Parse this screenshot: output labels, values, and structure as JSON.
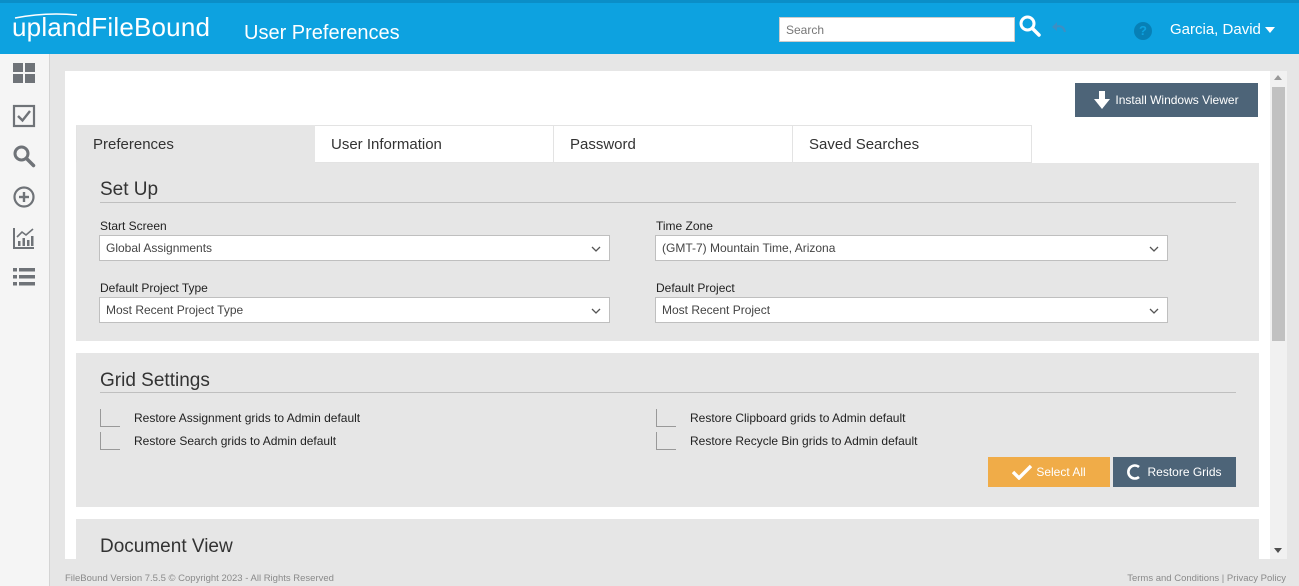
{
  "header": {
    "logo_prefix": "upland",
    "logo_name": "FileBound",
    "page_title": "User Preferences",
    "search_placeholder": "Search",
    "search_value": "",
    "search_icon": "search-icon",
    "back_icon": "undo-icon",
    "help_label": "?",
    "user_name": "Garcia, David",
    "brand_color": "#0da2e0"
  },
  "sidebar": {
    "items": [
      {
        "icon": "dashboard-icon"
      },
      {
        "icon": "assignments-checkbox-icon"
      },
      {
        "icon": "search-icon"
      },
      {
        "icon": "add-circle-icon"
      },
      {
        "icon": "reports-chart-icon"
      },
      {
        "icon": "list-icon"
      }
    ]
  },
  "main": {
    "install_button": "Install Windows Viewer",
    "tabs": [
      {
        "label": "Preferences",
        "active": true
      },
      {
        "label": "User Information",
        "active": false
      },
      {
        "label": "Password",
        "active": false
      },
      {
        "label": "Saved Searches",
        "active": false
      }
    ],
    "setup": {
      "title": "Set Up",
      "start_screen_label": "Start Screen",
      "start_screen_value": "Global Assignments",
      "time_zone_label": "Time Zone",
      "time_zone_value": "(GMT-7) Mountain Time, Arizona",
      "default_project_type_label": "Default Project Type",
      "default_project_type_value": "Most Recent Project Type",
      "default_project_label": "Default Project",
      "default_project_value": "Most Recent Project"
    },
    "grid_settings": {
      "title": "Grid Settings",
      "options": [
        {
          "label": "Restore Assignment grids to Admin default",
          "checked": false
        },
        {
          "label": "Restore Clipboard grids to Admin default",
          "checked": false
        },
        {
          "label": "Restore Search grids to Admin default",
          "checked": false
        },
        {
          "label": "Restore Recycle Bin grids to Admin default",
          "checked": false
        }
      ],
      "select_all_button": "Select All",
      "restore_button": "Restore Grids",
      "select_all_color": "#f0ac48",
      "restore_color": "#4d6478"
    },
    "document_view": {
      "title": "Document View"
    }
  },
  "footer": {
    "version_text": "FileBound Version 7.5.5 © Copyright 2023 - All Rights Reserved",
    "terms_link": "Terms and Conditions",
    "separator": "|",
    "privacy_link": "Privacy Policy"
  }
}
